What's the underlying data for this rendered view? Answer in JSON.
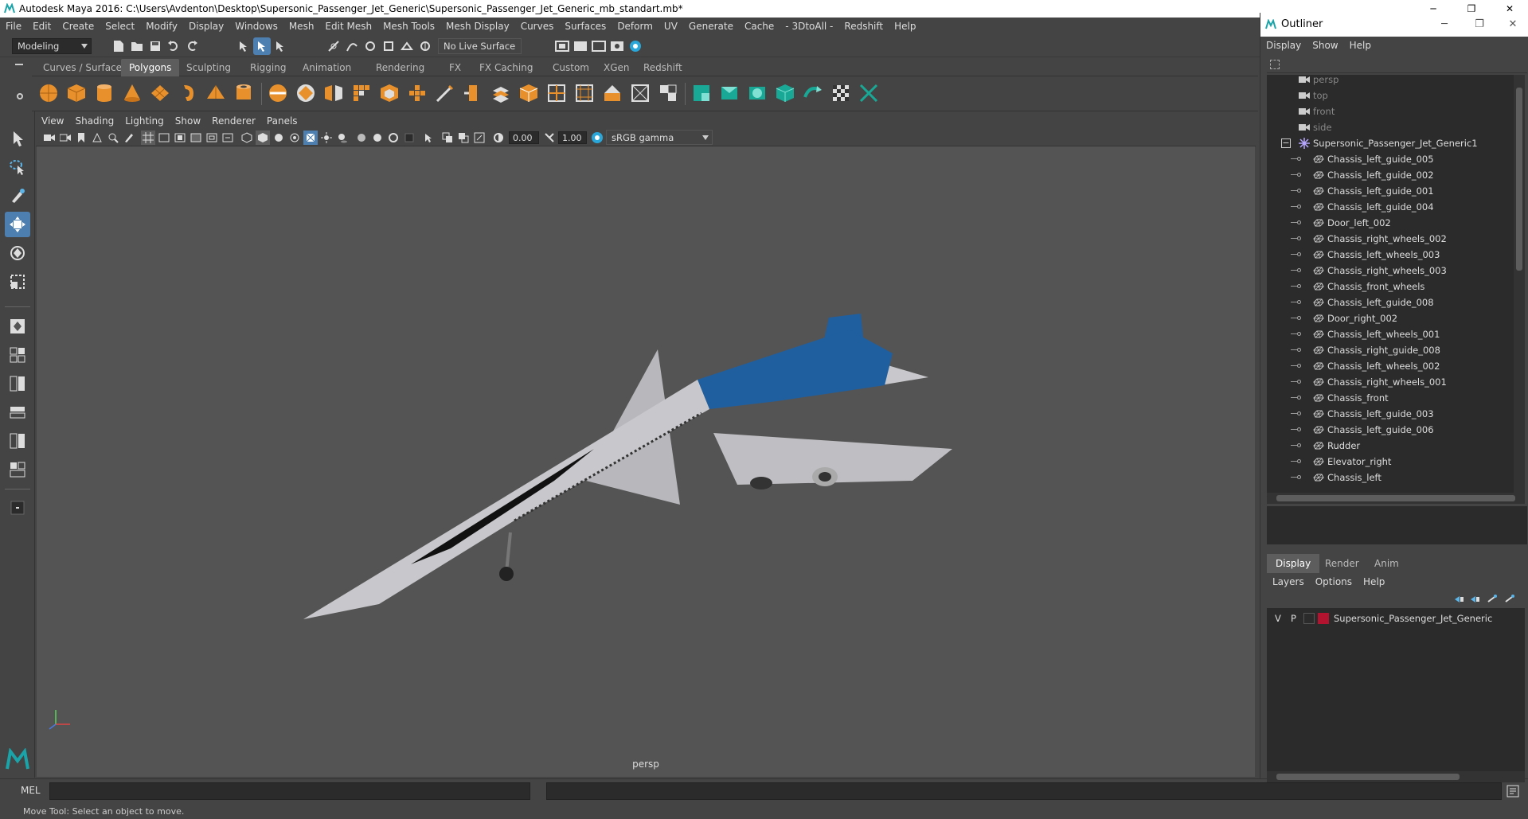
{
  "window": {
    "title": "Autodesk Maya 2016: C:\\Users\\Avdenton\\Desktop\\Supersonic_Passenger_Jet_Generic\\Supersonic_Passenger_Jet_Generic_mb_standart.mb*",
    "minimize": "─",
    "restore": "❐",
    "close": "✕"
  },
  "menu": [
    "File",
    "Edit",
    "Create",
    "Select",
    "Modify",
    "Display",
    "Windows",
    "Mesh",
    "Edit Mesh",
    "Mesh Tools",
    "Mesh Display",
    "Curves",
    "Surfaces",
    "Deform",
    "UV",
    "Generate",
    "Cache",
    "- 3DtoAll -",
    "Redshift",
    "Help"
  ],
  "status_line": {
    "mode": "Modeling",
    "live_surface": "No Live Surface"
  },
  "shelf_tabs": [
    "Curves / Surfaces",
    "Polygons",
    "Sculpting",
    "Rigging",
    "Animation",
    "Rendering",
    "FX",
    "FX Caching",
    "Custom",
    "XGen",
    "Redshift"
  ],
  "shelf_active": "Polygons",
  "panel_menu": [
    "View",
    "Shading",
    "Lighting",
    "Show",
    "Renderer",
    "Panels"
  ],
  "panel_toolbar": {
    "exposure": "0.00",
    "gamma": "1.00",
    "color_space": "sRGB gamma"
  },
  "viewport": {
    "camera_label": "persp",
    "model_colors": {
      "body": "#c8c8cc",
      "accent": "#1f5fa0",
      "window": "#111111"
    }
  },
  "command_line": {
    "language": "MEL"
  },
  "help_line": "Move Tool: Select an object to move.",
  "outliner": {
    "title": "Outliner",
    "menu": [
      "Display",
      "Show",
      "Help"
    ],
    "cameras": [
      "persp",
      "top",
      "front",
      "side"
    ],
    "group": "Supersonic_Passenger_Jet_Generic1",
    "group_collapse": "−",
    "children": [
      "Chassis_left_guide_005",
      "Chassis_left_guide_002",
      "Chassis_left_guide_001",
      "Chassis_left_guide_004",
      "Door_left_002",
      "Chassis_right_wheels_002",
      "Chassis_left_wheels_003",
      "Chassis_right_wheels_003",
      "Chassis_front_wheels",
      "Chassis_left_guide_008",
      "Door_right_002",
      "Chassis_left_wheels_001",
      "Chassis_right_guide_008",
      "Chassis_left_wheels_002",
      "Chassis_right_wheels_001",
      "Chassis_front",
      "Chassis_left_guide_003",
      "Chassis_left_guide_006",
      "Rudder",
      "Elevator_right",
      "Chassis_left"
    ]
  },
  "layer_editor": {
    "tabs": [
      "Display",
      "Render",
      "Anim"
    ],
    "active_tab": "Display",
    "menu": [
      "Layers",
      "Options",
      "Help"
    ],
    "layers": [
      {
        "v": "V",
        "p": "P",
        "name": "Supersonic_Passenger_Jet_Generic",
        "color": "#b3132f"
      }
    ]
  }
}
